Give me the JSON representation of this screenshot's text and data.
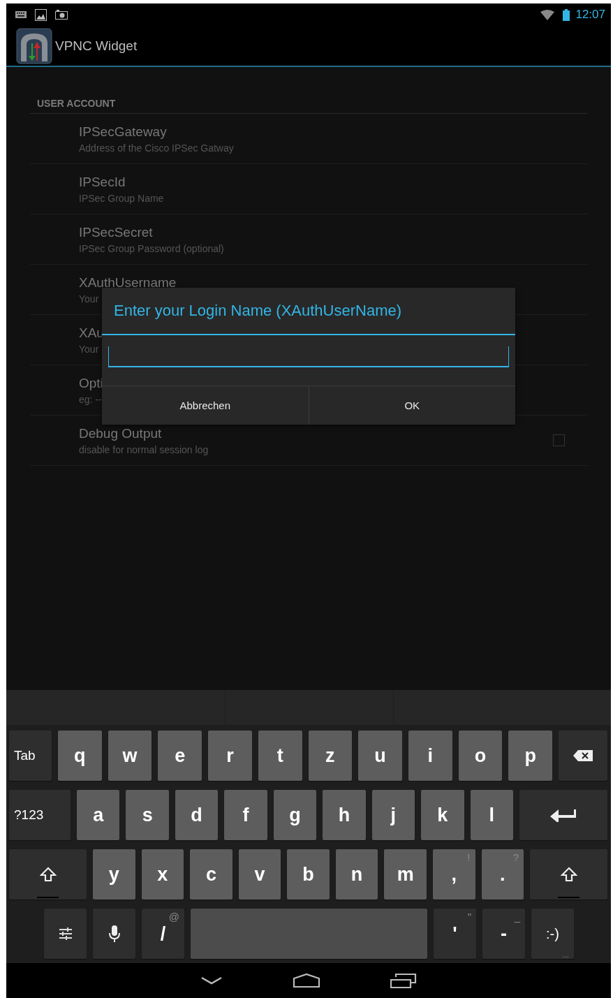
{
  "status_bar": {
    "time": "12:07"
  },
  "action_bar": {
    "title": "VPNC Widget"
  },
  "preferences": {
    "header": "USER ACCOUNT",
    "items": [
      {
        "kind": "text",
        "title": "IPSecGateway",
        "summary": "Address of the Cisco IPSec Gatway"
      },
      {
        "kind": "text",
        "title": "IPSecId",
        "summary": "IPSec Group Name"
      },
      {
        "kind": "text",
        "title": "IPSecSecret",
        "summary": "IPSec Group Password (optional)"
      },
      {
        "kind": "text",
        "title": "XAuthUsername",
        "summary": "Your"
      },
      {
        "kind": "text",
        "title": "XAu",
        "summary": "Your"
      },
      {
        "kind": "text",
        "title": "Opti",
        "summary": "eg: --"
      },
      {
        "kind": "checkbox",
        "title": "Debug Output",
        "summary": "disable for normal session log",
        "checked": false
      }
    ]
  },
  "dialog": {
    "title": "Enter your Login Name (XAuthUserName)",
    "buttons": [
      "Abbrechen",
      "OK"
    ]
  },
  "keyboard": {
    "rows": [
      [
        {
          "kind": "tab",
          "label": "Tab"
        },
        {
          "kind": "letter",
          "label": "q"
        },
        {
          "kind": "letter",
          "label": "w"
        },
        {
          "kind": "letter",
          "label": "e"
        },
        {
          "kind": "letter",
          "label": "r"
        },
        {
          "kind": "letter",
          "label": "t"
        },
        {
          "kind": "letter",
          "label": "z"
        },
        {
          "kind": "letter",
          "label": "u"
        },
        {
          "kind": "letter",
          "label": "i"
        },
        {
          "kind": "letter",
          "label": "o"
        },
        {
          "kind": "letter",
          "label": "p"
        },
        {
          "kind": "backspace"
        }
      ],
      [
        {
          "kind": "symbols",
          "label": "?123"
        },
        {
          "kind": "letter",
          "label": "a"
        },
        {
          "kind": "letter",
          "label": "s"
        },
        {
          "kind": "letter",
          "label": "d"
        },
        {
          "kind": "letter",
          "label": "f"
        },
        {
          "kind": "letter",
          "label": "g"
        },
        {
          "kind": "letter",
          "label": "h"
        },
        {
          "kind": "letter",
          "label": "j"
        },
        {
          "kind": "letter",
          "label": "k"
        },
        {
          "kind": "letter",
          "label": "l"
        },
        {
          "kind": "enter"
        }
      ],
      [
        {
          "kind": "shift"
        },
        {
          "kind": "letter",
          "label": "y"
        },
        {
          "kind": "letter",
          "label": "x"
        },
        {
          "kind": "letter",
          "label": "c"
        },
        {
          "kind": "letter",
          "label": "v"
        },
        {
          "kind": "letter",
          "label": "b"
        },
        {
          "kind": "letter",
          "label": "n"
        },
        {
          "kind": "letter",
          "label": "m"
        },
        {
          "kind": "letter",
          "label": ",",
          "hint": "!"
        },
        {
          "kind": "letter",
          "label": ".",
          "hint": "?"
        },
        {
          "kind": "shift"
        }
      ],
      [
        {
          "kind": "settings"
        },
        {
          "kind": "mic"
        },
        {
          "kind": "dark",
          "label": "/",
          "hint": "@"
        },
        {
          "kind": "space"
        },
        {
          "kind": "dark",
          "label": "'",
          "hint": "\""
        },
        {
          "kind": "dark",
          "label": "-",
          "hint": "_"
        },
        {
          "kind": "dark",
          "label": ":-)",
          "hint": "…"
        }
      ]
    ]
  }
}
